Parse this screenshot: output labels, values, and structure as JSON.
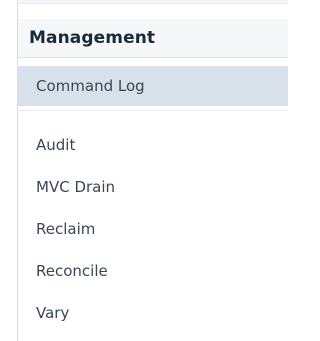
{
  "panel": {
    "header": "Management",
    "active_item": "Command Log",
    "items": [
      {
        "label": "Audit"
      },
      {
        "label": "MVC Drain"
      },
      {
        "label": "Reclaim"
      },
      {
        "label": "Reconcile"
      },
      {
        "label": "Vary"
      }
    ]
  },
  "colors": {
    "header_background": "#f6f7f9",
    "active_item_background": "#d8e1ea",
    "text": "#3a4656"
  }
}
